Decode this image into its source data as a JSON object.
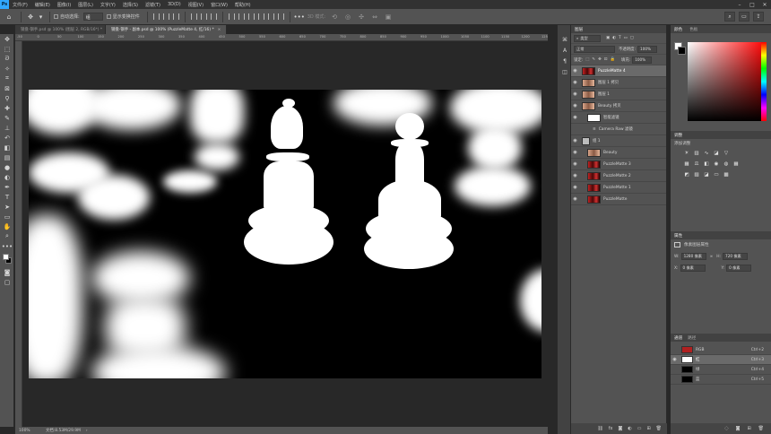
{
  "menubar": {
    "logo": "Ps",
    "items": [
      "文件(F)",
      "编辑(E)",
      "图像(I)",
      "图层(L)",
      "文字(Y)",
      "选择(S)",
      "滤镜(T)",
      "3D(D)",
      "视图(V)",
      "窗口(W)",
      "帮助(H)"
    ]
  },
  "options": {
    "auto_select_label": "自动选择:",
    "auto_select_value": "组",
    "transform_label": "显示变换控件",
    "mode_label": "3D 模式:"
  },
  "tabs": [
    {
      "label": "钢盘-钢手.psd @ 100% (图层 2, RGB/16*) *",
      "active": false
    },
    {
      "label": "钢盘-钢手 - 副本.psd @ 100% (PuzzleMatte 4, 红/16) *",
      "active": true
    }
  ],
  "ruler": {
    "numbers": [
      "-50",
      "0",
      "50",
      "100",
      "150",
      "200",
      "250",
      "300",
      "350",
      "400",
      "450",
      "500",
      "550",
      "600",
      "650",
      "700",
      "750",
      "800",
      "850",
      "900",
      "950",
      "1000",
      "1050",
      "1100",
      "1150",
      "1200",
      "1250"
    ]
  },
  "status": {
    "zoom": "100%",
    "doc": "文档:8.53M/29.9M"
  },
  "layers": {
    "panel_title": "图层",
    "kind_filter": "类型",
    "blend_mode": "正常",
    "opacity_label": "不透明度:",
    "opacity_value": "100%",
    "lock_label": "锁定:",
    "fill_label": "填充:",
    "fill_value": "100%",
    "items": [
      {
        "name": "PuzzleMatte 4",
        "thumb": "red",
        "indent": 0,
        "selected": true
      },
      {
        "name": "图层 1 拷贝",
        "thumb": "skin",
        "indent": 0,
        "selected": false
      },
      {
        "name": "图层 1",
        "thumb": "skin",
        "indent": 0,
        "selected": false
      },
      {
        "name": "Beauty 拷贝",
        "thumb": "skin",
        "indent": 0,
        "selected": false
      },
      {
        "name": "智能滤镜",
        "thumb": "white",
        "indent": 1,
        "selected": false
      },
      {
        "name": "Camera Raw 滤镜",
        "thumb": "none",
        "indent": 2,
        "selected": false
      },
      {
        "name": "组 1",
        "thumb": "folder",
        "indent": 0,
        "selected": false
      },
      {
        "name": "Beauty",
        "thumb": "skin",
        "indent": 1,
        "selected": false
      },
      {
        "name": "PuzzleMatte 3",
        "thumb": "red",
        "indent": 1,
        "selected": false
      },
      {
        "name": "PuzzleMatte 2",
        "thumb": "red",
        "indent": 1,
        "selected": false
      },
      {
        "name": "PuzzleMatte 1",
        "thumb": "red",
        "indent": 1,
        "selected": false
      },
      {
        "name": "PuzzleMatte",
        "thumb": "red",
        "indent": 1,
        "selected": false
      }
    ]
  },
  "color": {
    "tab_color": "颜色",
    "tab_swatches": "色板"
  },
  "adjustments": {
    "title": "调整",
    "add_label": "添加调整"
  },
  "properties": {
    "title": "属性",
    "layer_type": "像素图层属性",
    "w_label": "W:",
    "w_value": "1280 像素",
    "h_label": "H:",
    "h_value": "720 像素",
    "x_label": "X:",
    "x_value": "0 像素",
    "y_label": "Y:",
    "y_value": "0 像素"
  },
  "channels": {
    "tab_channels": "通道",
    "tab_paths": "路径",
    "items": [
      {
        "name": "RGB",
        "shortcut": "Ctrl+2",
        "color": "#b02020",
        "selected": false
      },
      {
        "name": "红",
        "shortcut": "Ctrl+3",
        "color": "#ffffff",
        "selected": true
      },
      {
        "name": "绿",
        "shortcut": "Ctrl+4",
        "color": "#000000",
        "selected": false
      },
      {
        "name": "蓝",
        "shortcut": "Ctrl+5",
        "color": "#000000",
        "selected": false
      }
    ]
  }
}
